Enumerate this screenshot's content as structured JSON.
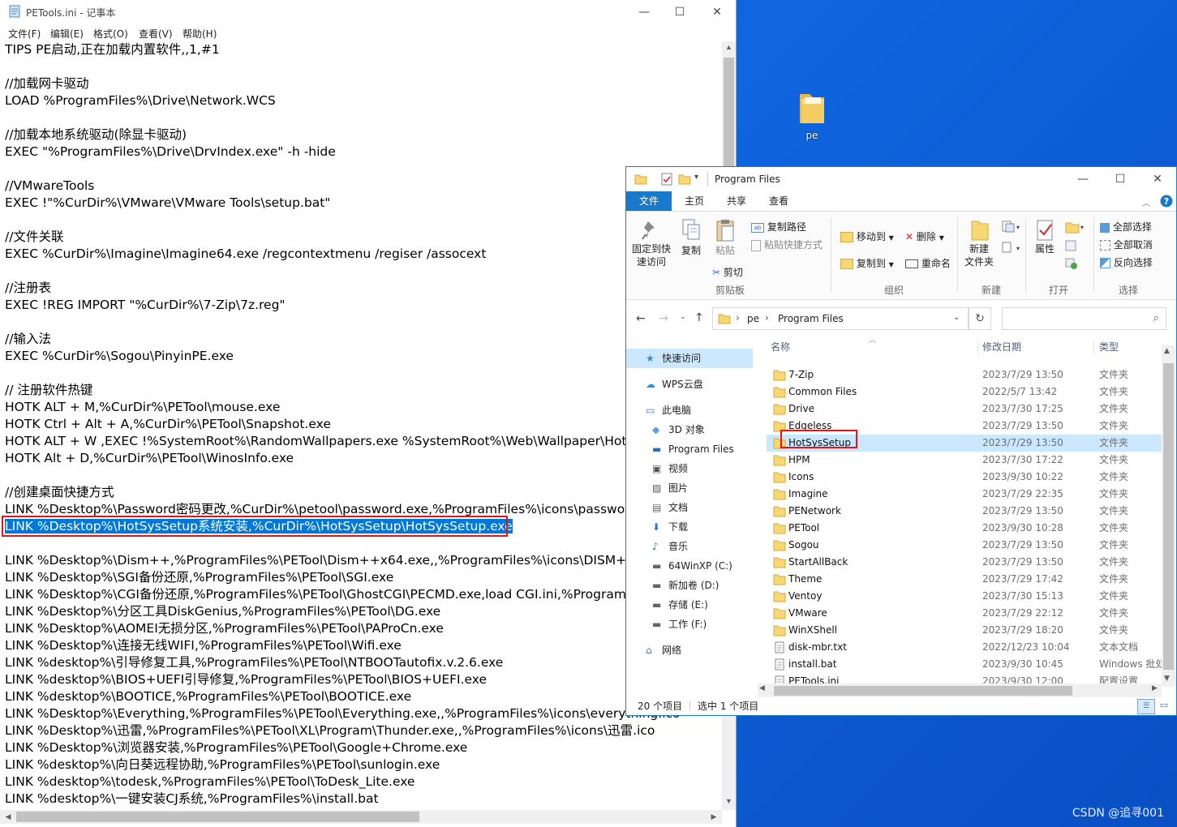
{
  "desktop": {
    "icon_label": "pe",
    "watermark": "CSDN @追寻001"
  },
  "notepad": {
    "title": "PETools.ini - 记事本",
    "menu": [
      "文件(F)",
      "编辑(E)",
      "格式(O)",
      "查看(V)",
      "帮助(H)"
    ],
    "lines": [
      "TIPS PE启动,正在加载内置软件,,1,#1",
      "",
      "//加载网卡驱动",
      "LOAD %ProgramFiles%\\Drive\\Network.WCS",
      "",
      "//加载本地系统驱动(除显卡驱动)",
      "EXEC \"%ProgramFiles%\\Drive\\DrvIndex.exe\" -h -hide",
      "",
      "//VMwareTools",
      "EXEC !\"%CurDir%\\VMware\\VMware Tools\\setup.bat\"",
      "",
      "//文件关联",
      "EXEC %CurDir%\\Imagine\\Imagine64.exe /regcontextmenu /regiser /assocext",
      "",
      "//注册表",
      "EXEC !REG IMPORT \"%CurDir%\\7-Zip\\7z.reg\"",
      "",
      "//输入法",
      "EXEC %CurDir%\\Sogou\\PinyinPE.exe",
      "",
      "// 注册软件热键",
      "HOTK ALT + M,%CurDir%\\PETool\\mouse.exe",
      "HOTK Ctrl + Alt + A,%CurDir%\\PETool\\Snapshot.exe",
      "HOTK ALT + W ,EXEC !%SystemRoot%\\RandomWallpapers.exe %SystemRoot%\\Web\\Wallpaper\\HotP",
      "HOTK Alt + D,%CurDir%\\PETool\\WinosInfo.exe",
      "",
      "//创建桌面快捷方式",
      "LINK %Desktop%\\Password密码更改,%CurDir%\\petool\\password.exe,%ProgramFiles%\\icons\\passwor",
      "LINK %Desktop%\\HotSysSetup系统安装,%CurDir%\\HotSysSetup\\HotSysSetup.exe",
      "",
      "LINK %Desktop%\\Dism++,%ProgramFiles%\\PETool\\Dism++x64.exe,,%ProgramFiles%\\icons\\DISM++",
      "LINK %Desktop%\\SGI备份还原,%ProgramFiles%\\PETool\\SGI.exe",
      "LINK %Desktop%\\CGI备份还原,%ProgramFiles%\\PETool\\GhostCGI\\PECMD.exe,load CGI.ini,%Program",
      "LINK %Desktop%\\分区工具DiskGenius,%ProgramFiles%\\PETool\\DG.exe",
      "LINK %Desktop%\\AOMEI无损分区,%ProgramFiles%\\PETool\\PAProCn.exe",
      "LINK %Desktop%\\连接无线WIFI,%ProgramFiles%\\PETool\\Wifi.exe",
      "LINK %desktop%\\引导修复工具,%ProgramFiles%\\PETool\\NTBOOTautofix.v.2.6.exe",
      "LINK %desktop%\\BIOS+UEFI引导修复,%ProgramFiles%\\PETool\\BIOS+UEFI.exe",
      "LINK %desktop%\\BOOTICE,%ProgramFiles%\\PETool\\BOOTICE.exe",
      "LINK %Desktop%\\Everything,%ProgramFiles%\\PETool\\Everything.exe,,%ProgramFiles%\\icons\\everything.ico",
      "LINK %Desktop%\\迅雷,%ProgramFiles%\\PETool\\XL\\Program\\Thunder.exe,,%ProgramFiles%\\icons\\迅雷.ico",
      "LINK %Desktop%\\浏览器安装,%ProgramFiles%\\PETool\\Google+Chrome.exe",
      "LINK %desktop%\\向日葵远程协助,%ProgramFiles%\\PETool\\sunlogin.exe",
      "LINK %desktop%\\todesk,%ProgramFiles%\\PETool\\ToDesk_Lite.exe",
      "LINK %desktop%\\一键安装CJ系统,%ProgramFiles%\\install.bat"
    ],
    "selected_line_index": 28
  },
  "explorer": {
    "title": "Program Files",
    "tabs": [
      "文件",
      "主页",
      "共享",
      "查看"
    ],
    "ribbon": {
      "pin": "固定到快\n速访问",
      "copy": "复制",
      "paste": "粘贴",
      "copy_path": "复制路径",
      "paste_shortcut": "粘贴快捷方式",
      "cut": "剪切",
      "clipboard_group": "剪贴板",
      "move_to": "移动到",
      "copy_to": "复制到",
      "delete": "删除",
      "rename": "重命名",
      "organize_group": "组织",
      "new_folder": "新建\n文件夹",
      "new_group": "新建",
      "properties": "属性",
      "open_group": "打开",
      "select_all": "全部选择",
      "select_none": "全部取消",
      "invert": "反向选择",
      "select_group": "选择"
    },
    "breadcrumb": [
      "pe",
      "Program Files"
    ],
    "nav": [
      {
        "label": "快速访问",
        "icon": "star-icon"
      },
      {
        "label": "WPS云盘",
        "icon": "cloud-icon"
      },
      {
        "label": "此电脑",
        "icon": "computer-icon"
      },
      {
        "label": "3D 对象",
        "icon": "cube-icon"
      },
      {
        "label": "Program Files",
        "icon": "desktop-icon"
      },
      {
        "label": "视频",
        "icon": "video-icon"
      },
      {
        "label": "图片",
        "icon": "picture-icon"
      },
      {
        "label": "文档",
        "icon": "document-icon"
      },
      {
        "label": "下载",
        "icon": "download-icon"
      },
      {
        "label": "音乐",
        "icon": "music-icon"
      },
      {
        "label": "64WinXP  (C:)",
        "icon": "drive-icon"
      },
      {
        "label": "新加卷 (D:)",
        "icon": "drive-icon"
      },
      {
        "label": "存储 (E:)",
        "icon": "drive-icon"
      },
      {
        "label": "工作 (F:)",
        "icon": "drive-icon"
      },
      {
        "label": "网络",
        "icon": "network-icon"
      }
    ],
    "columns": [
      "名称",
      "修改日期",
      "类型"
    ],
    "files": [
      {
        "name": "7-Zip",
        "date": "2023/7/29 13:50",
        "type": "文件夹",
        "kind": "folder"
      },
      {
        "name": "Common Files",
        "date": "2022/5/7 13:42",
        "type": "文件夹",
        "kind": "folder"
      },
      {
        "name": "Drive",
        "date": "2023/7/30 17:25",
        "type": "文件夹",
        "kind": "folder"
      },
      {
        "name": "Edgeless",
        "date": "2023/7/29 13:50",
        "type": "文件夹",
        "kind": "folder"
      },
      {
        "name": "HotSysSetup",
        "date": "2023/7/29 13:50",
        "type": "文件夹",
        "kind": "folder"
      },
      {
        "name": "HPM",
        "date": "2023/7/30 17:22",
        "type": "文件夹",
        "kind": "folder"
      },
      {
        "name": "Icons",
        "date": "2023/9/30 10:22",
        "type": "文件夹",
        "kind": "folder"
      },
      {
        "name": "Imagine",
        "date": "2023/7/29 22:35",
        "type": "文件夹",
        "kind": "folder"
      },
      {
        "name": "PENetwork",
        "date": "2023/7/29 13:50",
        "type": "文件夹",
        "kind": "folder"
      },
      {
        "name": "PETool",
        "date": "2023/9/30 10:28",
        "type": "文件夹",
        "kind": "folder"
      },
      {
        "name": "Sogou",
        "date": "2023/7/29 13:50",
        "type": "文件夹",
        "kind": "folder"
      },
      {
        "name": "StartAllBack",
        "date": "2023/7/29 13:50",
        "type": "文件夹",
        "kind": "folder"
      },
      {
        "name": "Theme",
        "date": "2023/7/29 17:42",
        "type": "文件夹",
        "kind": "folder"
      },
      {
        "name": "Ventoy",
        "date": "2023/7/30 15:13",
        "type": "文件夹",
        "kind": "folder"
      },
      {
        "name": "VMware",
        "date": "2023/7/29 22:12",
        "type": "文件夹",
        "kind": "folder"
      },
      {
        "name": "WinXShell",
        "date": "2023/7/29 18:20",
        "type": "文件夹",
        "kind": "folder"
      },
      {
        "name": "disk-mbr.txt",
        "date": "2022/12/23 10:04",
        "type": "文本文档",
        "kind": "txt"
      },
      {
        "name": "install.bat",
        "date": "2023/9/30 10:45",
        "type": "Windows 批处理",
        "kind": "bat"
      },
      {
        "name": "PETools.ini",
        "date": "2023/9/30 12:00",
        "type": "配置设置",
        "kind": "ini"
      }
    ],
    "selected_file_index": 4,
    "status_count": "20 个项目",
    "status_selected": "选中 1 个项目"
  },
  "colors": {
    "accent": "#1979ca",
    "selection": "#0078d7",
    "highlight_box": "#e11111",
    "folder": "#f8d775"
  }
}
